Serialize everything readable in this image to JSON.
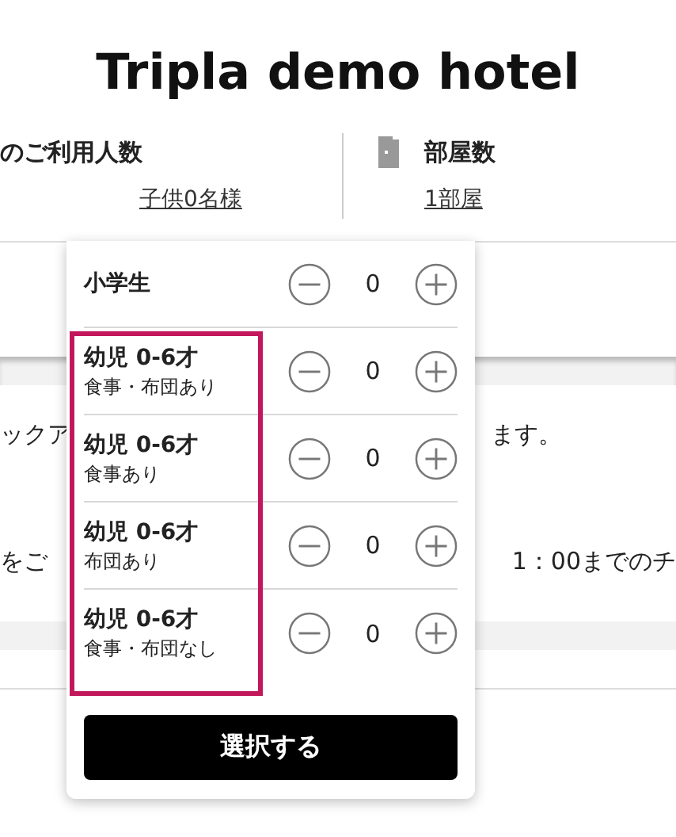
{
  "title": "Tripla demo hotel",
  "guests": {
    "label": "のご利用人数",
    "value": "子供0名様"
  },
  "rooms": {
    "label": "部屋数",
    "value": "1部屋"
  },
  "background_lines": [
    {
      "left": "ックア",
      "right": "ます。"
    },
    {
      "left": "をご",
      "right": "1：00までのチ"
    }
  ],
  "popup": {
    "counters": [
      {
        "label": "小学生",
        "value": "0"
      }
    ],
    "highlighted_counters": [
      {
        "label": "幼児 0-6才",
        "note": "食事・布団あり",
        "value": "0"
      },
      {
        "label": "幼児 0-6才",
        "note": "食事あり",
        "value": "0"
      },
      {
        "label": "幼児 0-6才",
        "note": "布団あり",
        "value": "0"
      },
      {
        "label": "幼児 0-6才",
        "note": "食事・布団なし",
        "value": "0"
      }
    ],
    "button": "選択する"
  }
}
